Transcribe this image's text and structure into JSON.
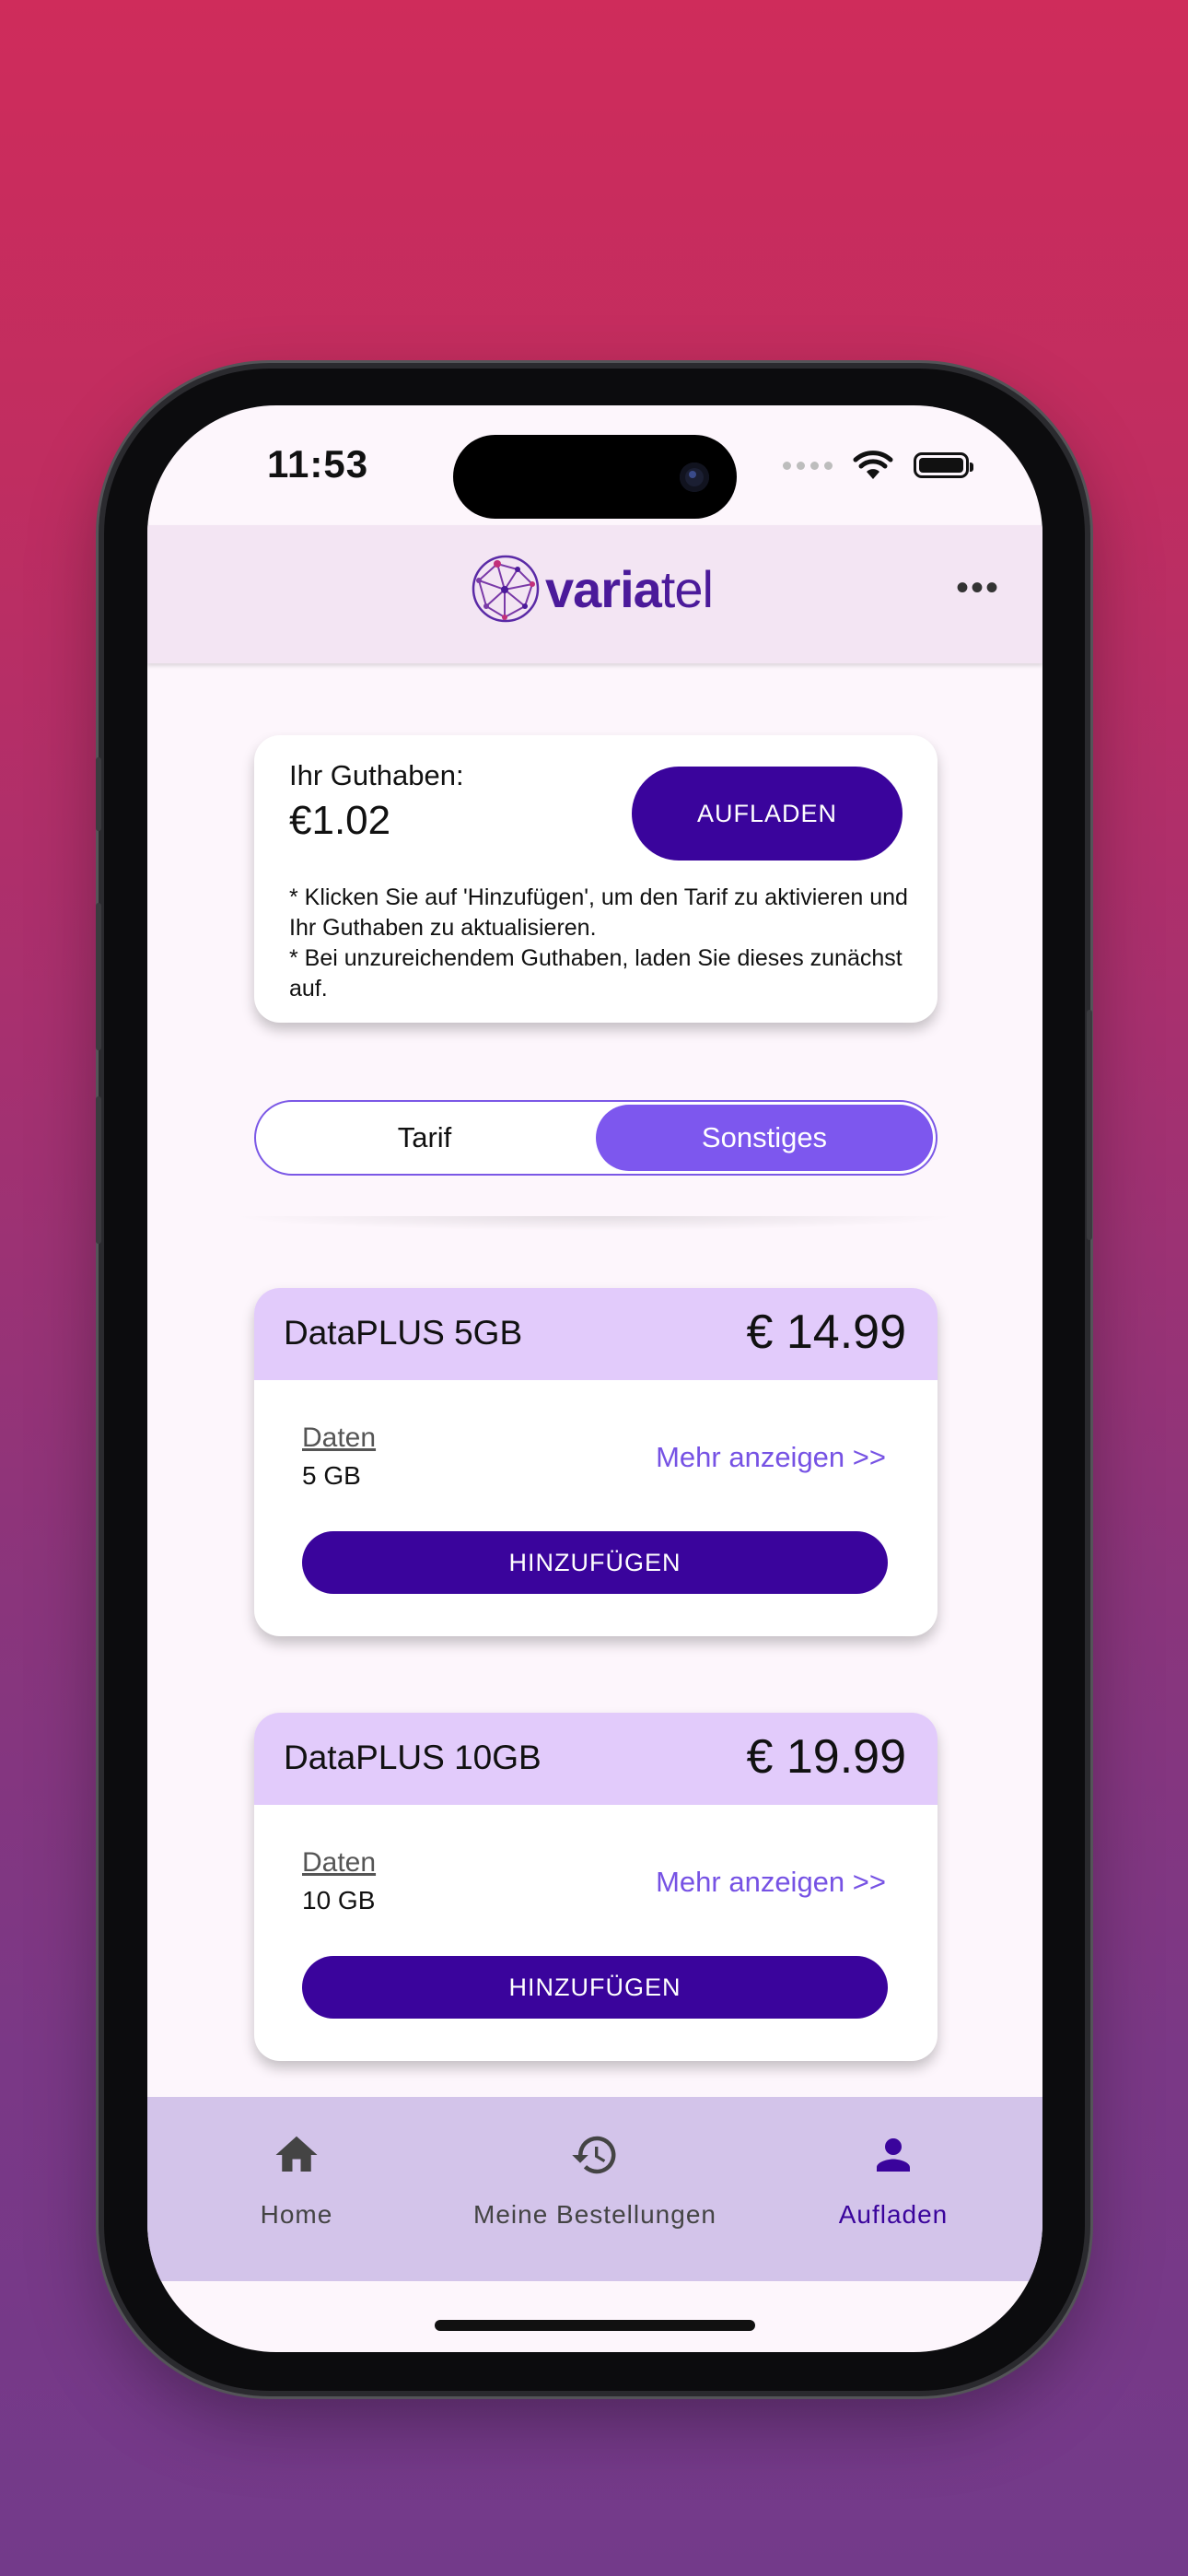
{
  "status_bar": {
    "time": "11:53"
  },
  "app_bar": {
    "logo_part1": "varia",
    "logo_part2": "tel",
    "menu_icon": "more-horizontal-icon"
  },
  "balance": {
    "label": "Ihr Guthaben:",
    "value": "€1.02",
    "topup_label": "AUFLADEN",
    "note_line1": "* Klicken Sie auf 'Hinzufügen', um den Tarif zu aktivieren und Ihr Guthaben zu aktualisieren.",
    "note_line2": "* Bei unzureichendem Guthaben, laden Sie dieses zunächst auf."
  },
  "segments": {
    "tab1": "Tarif",
    "tab2": "Sonstiges",
    "selected": "Sonstiges"
  },
  "plans": [
    {
      "name": "DataPLUS 5GB",
      "price": "€ 14.99",
      "data_label": "Daten",
      "data_value": "5 GB",
      "more": "Mehr anzeigen >>",
      "add_label": "HINZUFÜGEN"
    },
    {
      "name": "DataPLUS 10GB",
      "price": "€ 19.99",
      "data_label": "Daten",
      "data_value": "10 GB",
      "more": "Mehr anzeigen >>",
      "add_label": "HINZUFÜGEN"
    }
  ],
  "bottom_nav": {
    "items": [
      {
        "label": "Home",
        "icon": "home-icon"
      },
      {
        "label": "Meine Bestellungen",
        "icon": "history-icon"
      },
      {
        "label": "Aufladen",
        "icon": "person-icon"
      }
    ],
    "active": "Aufladen"
  },
  "colors": {
    "primary": "#3a049c",
    "accent": "#7d57ee",
    "plan_header": "#e2cbfb",
    "nav_bg": "#d3c4ea"
  }
}
